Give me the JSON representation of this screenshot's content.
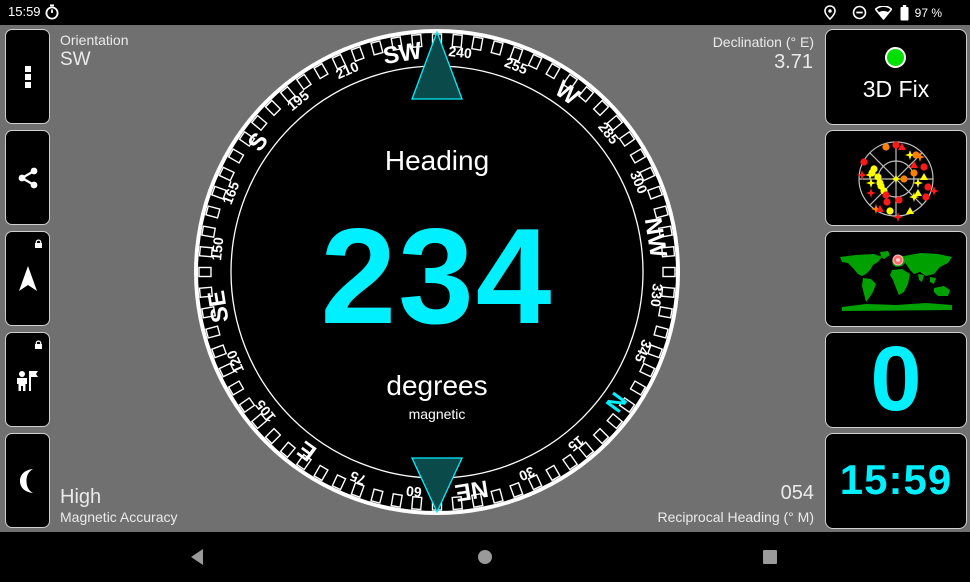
{
  "status_bar": {
    "time": "15:59",
    "left_icons": [
      "timer-icon"
    ],
    "right_icons": [
      "location-icon",
      "do-not-disturb-icon",
      "wifi-icon",
      "battery-icon"
    ],
    "battery_percent": "97 %"
  },
  "sidebar_left": {
    "buttons": [
      {
        "name": "menu",
        "icon": "more-vertical-icon",
        "locked": false
      },
      {
        "name": "share",
        "icon": "share-icon",
        "locked": false
      },
      {
        "name": "navigation",
        "icon": "navigation-arrow-icon",
        "locked": true
      },
      {
        "name": "waypoint",
        "icon": "person-flag-icon",
        "locked": true
      },
      {
        "name": "night-mode",
        "icon": "moon-icon",
        "locked": false
      }
    ]
  },
  "info": {
    "orientation_label": "Orientation",
    "orientation_value": "SW",
    "declination_label": "Declination (° E)",
    "declination_value": "3.71",
    "accuracy_value": "High",
    "accuracy_label": "Magnetic Accuracy",
    "reciprocal_value": "054",
    "reciprocal_label": "Reciprocal Heading (° M)"
  },
  "compass": {
    "heading_label": "Heading",
    "heading_value": "234",
    "heading_degrees": 234,
    "units_label": "degrees",
    "reference_label": "magnetic",
    "cardinal_labels": [
      {
        "text": "N",
        "bearing": 0,
        "highlight": true
      },
      {
        "text": "NE",
        "bearing": 45
      },
      {
        "text": "E",
        "bearing": 90
      },
      {
        "text": "SE",
        "bearing": 135
      },
      {
        "text": "S",
        "bearing": 180
      },
      {
        "text": "SW",
        "bearing": 225
      },
      {
        "text": "W",
        "bearing": 270
      },
      {
        "text": "NW",
        "bearing": 315
      }
    ],
    "degree_labels": [
      "15",
      "30",
      "60",
      "75",
      "105",
      "120",
      "150",
      "165",
      "195",
      "210",
      "240",
      "255",
      "285",
      "300",
      "330",
      "345"
    ],
    "colors": {
      "accent": "#00f0ff",
      "marker_fill": "#0b4a4a",
      "dial": "#000000",
      "ring": "#ffffff"
    }
  },
  "tiles_right": {
    "fix_status": "3D Fix",
    "fix_color": "#00e000",
    "satellite_view_icon": "sky-plot-icon",
    "world_map_icon": "world-map-icon",
    "speed_value": "0",
    "clock_value": "15:59"
  },
  "nav_bar": {
    "buttons": [
      "back-icon",
      "home-icon",
      "recents-icon"
    ]
  }
}
